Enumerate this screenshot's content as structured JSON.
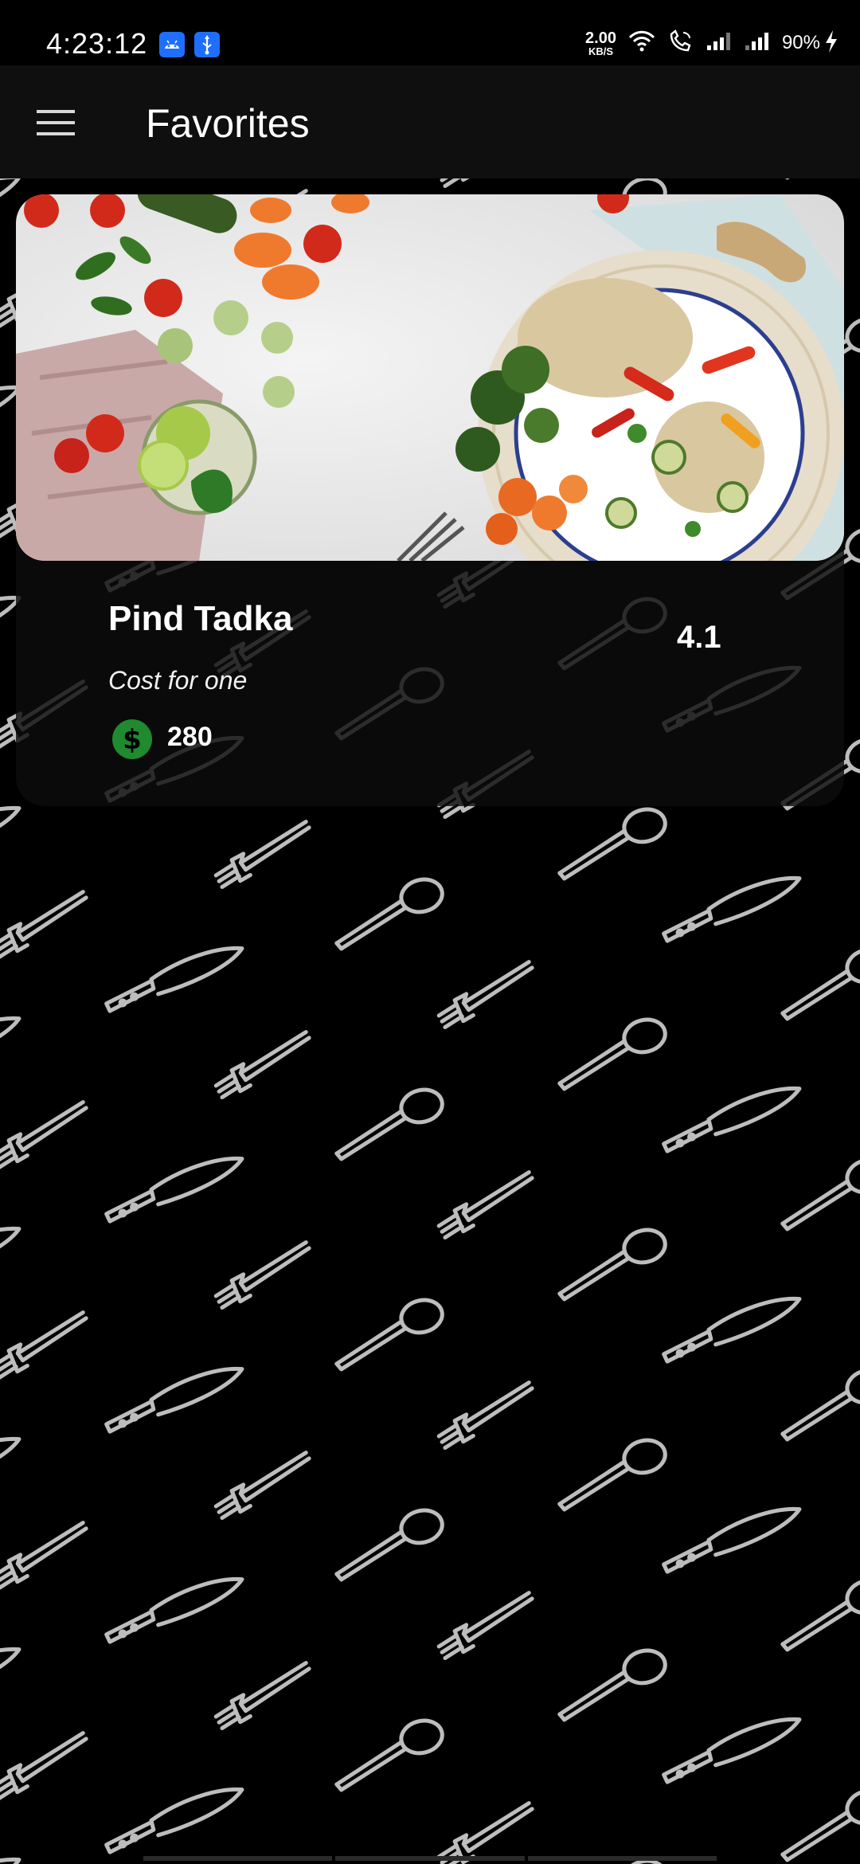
{
  "status_bar": {
    "time": "4:23:12",
    "net_speed_value": "2.00",
    "net_speed_unit": "KB/S",
    "battery": "90%",
    "icons": [
      "android-icon",
      "usb-icon",
      "wifi-icon",
      "wifi-calling-icon",
      "signal-icon",
      "signal-icon-2",
      "charging-icon"
    ]
  },
  "app_bar": {
    "title": "Favorites",
    "menu_icon": "hamburger-menu-icon"
  },
  "favorites": [
    {
      "name": "Pind Tadka",
      "cost_label": "Cost for one",
      "price": "280",
      "price_icon": "dollar-coin-icon",
      "rating": "4.1",
      "image": "food-bowl-photo"
    }
  ],
  "colors": {
    "background": "#000000",
    "app_bar": "#0f0f0f",
    "card": "#0c0c0c",
    "price_icon": "#1f8a2e",
    "accent_status": "#1e6fff"
  }
}
